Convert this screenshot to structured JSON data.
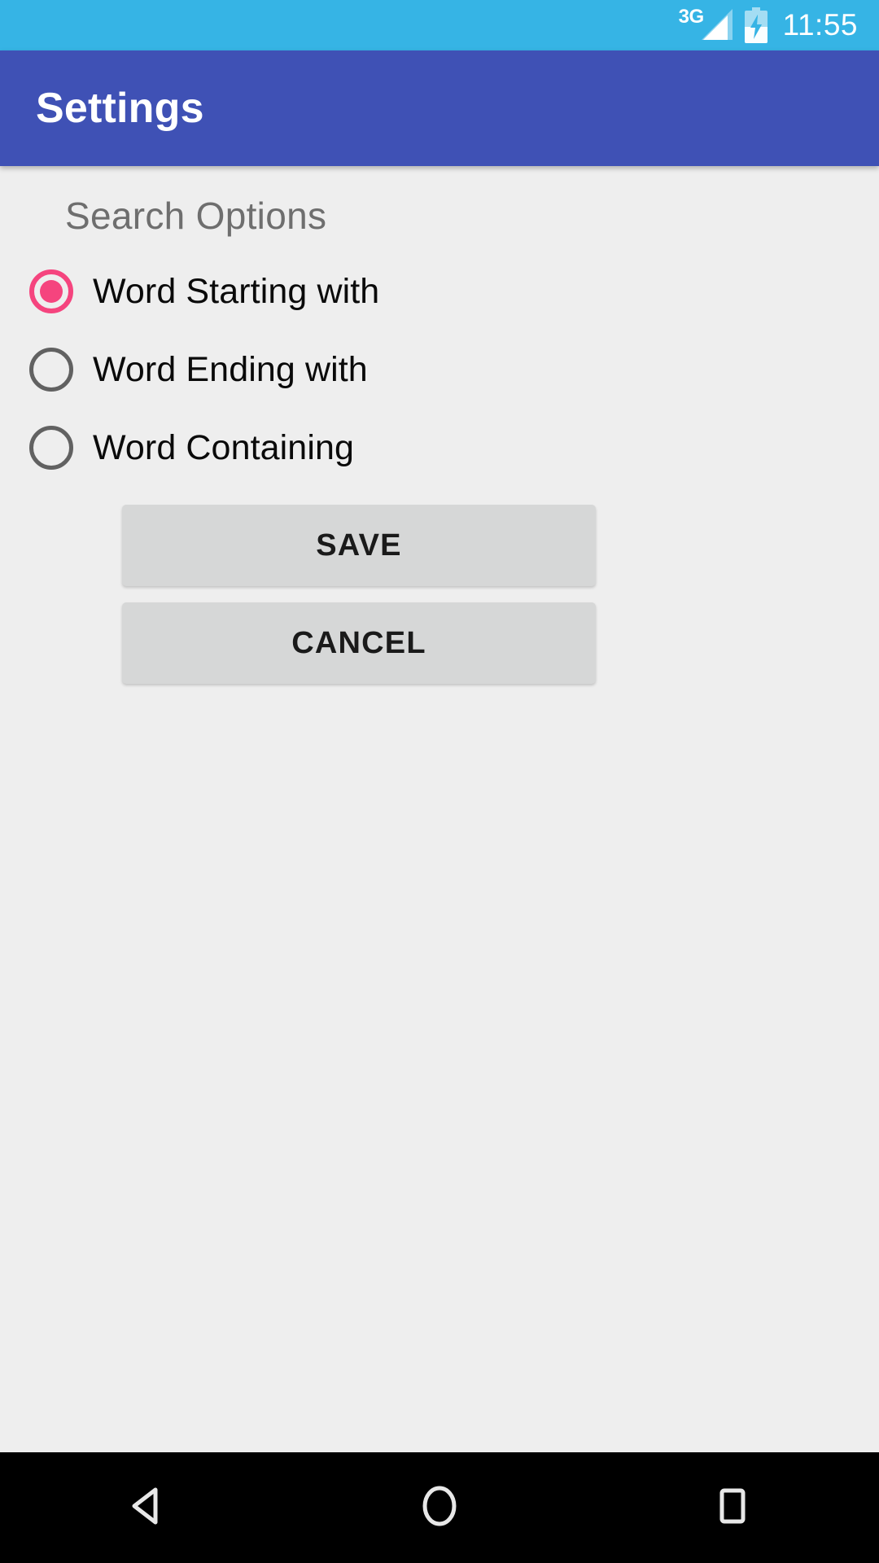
{
  "status_bar": {
    "network_label": "3G",
    "signal_icon": "signal-bars-icon",
    "battery_icon": "battery-charging-icon",
    "time": "11:55",
    "background_color": "#36B4E5"
  },
  "app_bar": {
    "title": "Settings",
    "background_color": "#3F51B5"
  },
  "main": {
    "section_title": "Search Options",
    "radio_options": [
      {
        "label": "Word Starting with",
        "selected": true
      },
      {
        "label": "Word Ending with",
        "selected": false
      },
      {
        "label": "Word Containing",
        "selected": false
      }
    ],
    "selected_color": "#F5447E",
    "unselected_color": "#616161",
    "buttons": [
      {
        "label": "SAVE",
        "name": "save-button"
      },
      {
        "label": "CANCEL",
        "name": "cancel-button"
      }
    ],
    "button_color": "#D6D7D7",
    "background_color": "#EEEEEE"
  },
  "nav_bar": {
    "background_color": "#000000",
    "items": [
      {
        "icon": "back-triangle-icon",
        "name": "nav-back-button"
      },
      {
        "icon": "home-circle-icon",
        "name": "nav-home-button"
      },
      {
        "icon": "recents-square-icon",
        "name": "nav-recents-button"
      }
    ]
  }
}
